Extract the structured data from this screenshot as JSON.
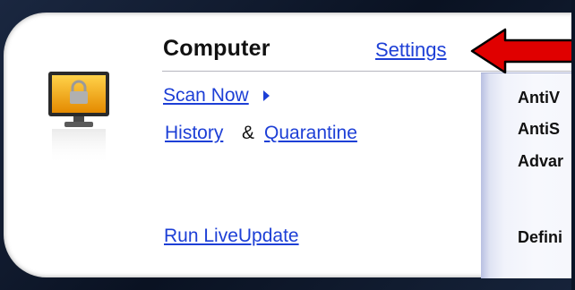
{
  "section": {
    "title": "Computer",
    "settings_label": "Settings"
  },
  "links": {
    "scan_now": "Scan Now",
    "history": "History",
    "ampersand": "&",
    "quarantine": "Quarantine",
    "run_liveupdate": "Run LiveUpdate"
  },
  "status": {
    "antivirus": "AntiV",
    "antispyware": "AntiS",
    "advanced": "Advar",
    "definitions": "Defini"
  },
  "icons": {
    "computer": "locked-monitor-icon",
    "scan_now_arrow": "triangle-right-icon",
    "callout": "red-arrow-callout-icon"
  },
  "colors": {
    "link": "#1d3fd6",
    "callout_fill": "#e00000",
    "monitor_screen": "#f2a10a"
  }
}
